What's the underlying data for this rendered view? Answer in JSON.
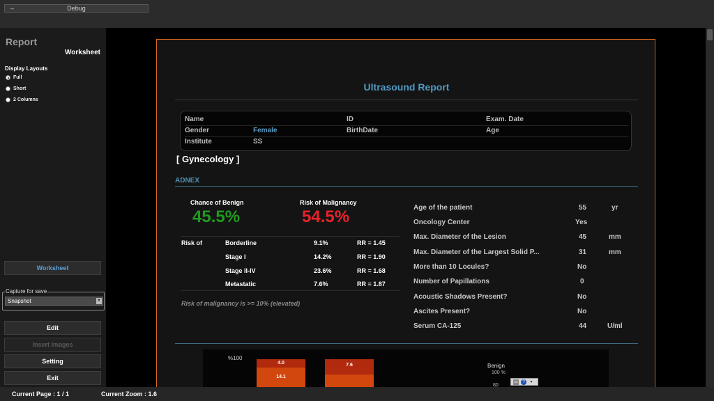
{
  "topbar": {
    "debug_label": "Debug",
    "minus": "–"
  },
  "sidebar": {
    "title": "Report",
    "subtitle": "Worksheet",
    "layouts_label": "Display Layouts",
    "layouts": [
      {
        "label": "Full",
        "selected": true
      },
      {
        "label": "Short",
        "selected": false
      },
      {
        "label": "2 Columns",
        "selected": false
      }
    ],
    "worksheet_button": "Worksheet",
    "capture_label": "Capture for save",
    "capture_value": "Snapshot",
    "edit_button": "Edit",
    "insert_images_button": "Insert Images",
    "setting_button": "Setting",
    "exit_button": "Exit"
  },
  "report": {
    "title": "Ultrasound Report",
    "patient": {
      "name_label": "Name",
      "id_label": "ID",
      "exam_date_label": "Exam. Date",
      "gender_label": "Gender",
      "gender_value": "Female",
      "birthdate_label": "BirthDate",
      "age_label": "Age",
      "institute_label": "Institute",
      "institute_value": "SS"
    },
    "section": "[ Gynecology ]",
    "adnex_label": "ADNEX",
    "benign_label": "Chance of Benign",
    "benign_value": "45.5%",
    "malignancy_label": "Risk of Malignancy",
    "malignancy_value": "54.5%",
    "risk_of_label": "Risk of",
    "risk_rows": [
      {
        "name": "Borderline",
        "pct": "9.1%",
        "rr": "RR = 1.45"
      },
      {
        "name": "Stage I",
        "pct": "14.2%",
        "rr": "RR = 1.90"
      },
      {
        "name": "Stage II-IV",
        "pct": "23.6%",
        "rr": "RR = 1.68"
      },
      {
        "name": "Metastatic",
        "pct": "7.6%",
        "rr": "RR = 1.87"
      }
    ],
    "note": "Risk of malignancy is >= 10% (elevated)",
    "params": [
      {
        "label": "Age of the patient",
        "value": "55",
        "unit": "yr"
      },
      {
        "label": "Oncology Center",
        "value": "Yes",
        "unit": ""
      },
      {
        "label": "Max. Diameter of the Lesion",
        "value": "45",
        "unit": "mm"
      },
      {
        "label": "Max. Diameter of the Largest Solid P...",
        "value": "31",
        "unit": "mm"
      },
      {
        "label": "More than 10 Locules?",
        "value": "No",
        "unit": ""
      },
      {
        "label": "Number of Papillations",
        "value": "0",
        "unit": ""
      },
      {
        "label": "Acoustic Shadows Present?",
        "value": "No",
        "unit": ""
      },
      {
        "label": "Ascites Present?",
        "value": "No",
        "unit": ""
      },
      {
        "label": "Serum CA-125",
        "value": "44",
        "unit": "U/ml"
      }
    ],
    "chart": {
      "y_label": "%100",
      "bar1_top": "4.0",
      "bar1_bottom": "14.1",
      "bar2_top": "7.6",
      "radar_title": "Benign",
      "radar_100": "100 %",
      "radar_80": "80"
    }
  },
  "status": {
    "page": "Current Page : 1 / 1",
    "zoom": "Current Zoom : 1.6"
  },
  "colors": {
    "benign": "#1f9a1f",
    "malignancy": "#e8222a",
    "accent": "#4f9ac4",
    "report_border": "#d2691e"
  }
}
